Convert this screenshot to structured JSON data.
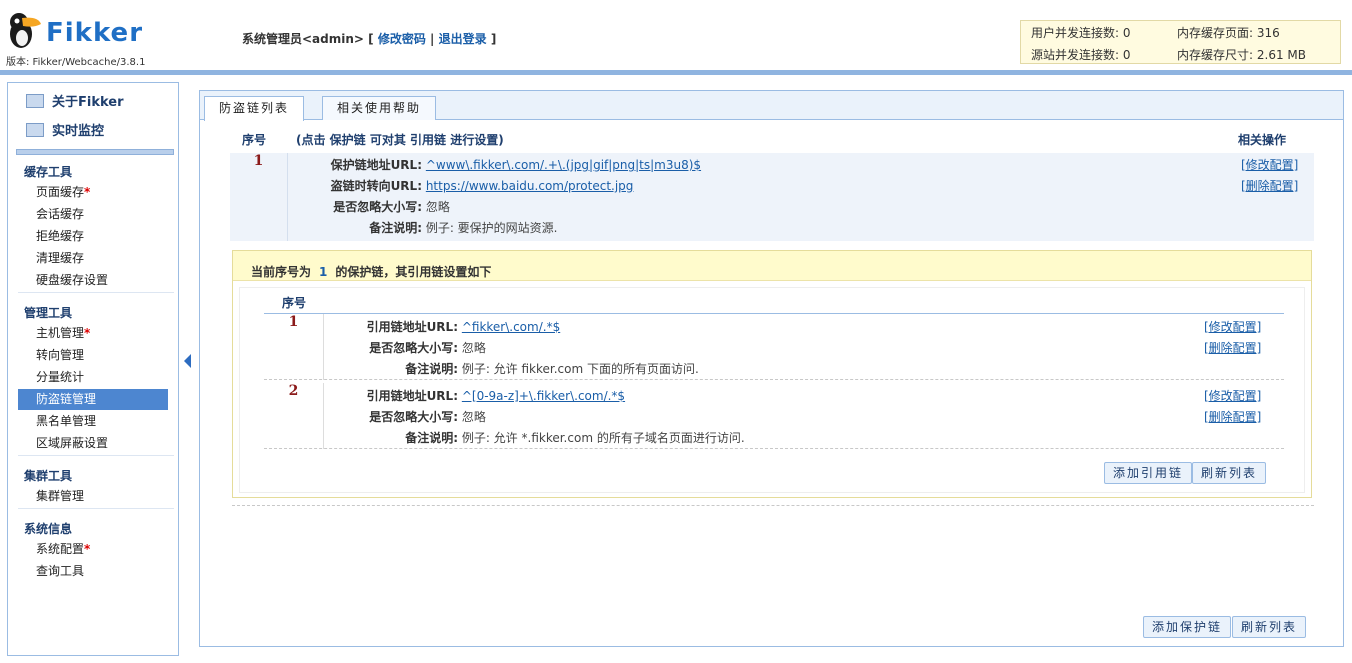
{
  "header": {
    "brand": "Fikker",
    "version": "版本: Fikker/Webcache/3.8.1",
    "user": "系统管理员<admin>",
    "bracket_open": "[",
    "change_password": "修改密码",
    "separator": "|",
    "logout": "退出登录",
    "bracket_close": "]"
  },
  "stats": {
    "user_conn_label": "用户并发连接数:",
    "user_conn_value": "0",
    "origin_conn_label": "源站并发连接数:",
    "origin_conn_value": "0",
    "mem_pages_label": "内存缓存页面:",
    "mem_pages_value": "316",
    "mem_size_label": "内存缓存尺寸:",
    "mem_size_value": "2.61 MB"
  },
  "sidebar": {
    "top": [
      {
        "label": "关于Fikker",
        "icon": "monitor-icon"
      },
      {
        "label": "实时监控",
        "icon": "chart-icon"
      }
    ],
    "groups": [
      {
        "title": "缓存工具",
        "items": [
          {
            "label": "页面缓存",
            "req": "*"
          },
          {
            "label": "会话缓存",
            "req": ""
          },
          {
            "label": "拒绝缓存",
            "req": ""
          },
          {
            "label": "清理缓存",
            "req": ""
          },
          {
            "label": "硬盘缓存设置",
            "req": ""
          }
        ]
      },
      {
        "title": "管理工具",
        "items": [
          {
            "label": "主机管理",
            "req": "*"
          },
          {
            "label": "转向管理",
            "req": ""
          },
          {
            "label": "分量统计",
            "req": ""
          },
          {
            "label": "防盗链管理",
            "req": ""
          },
          {
            "label": "黑名单管理",
            "req": ""
          },
          {
            "label": "区域屏蔽设置",
            "req": ""
          }
        ]
      },
      {
        "title": "集群工具",
        "items": [
          {
            "label": "集群管理",
            "req": ""
          }
        ]
      },
      {
        "title": "系统信息",
        "items": [
          {
            "label": "系统配置",
            "req": "*"
          },
          {
            "label": "查询工具",
            "req": ""
          }
        ]
      }
    ]
  },
  "tabs": [
    "防盗链列表",
    "相关使用帮助"
  ],
  "table": {
    "col_index": "序号",
    "col_hint": "(点击 保护链 可对其 引用链 进行设置)",
    "col_ops": "相关操作"
  },
  "chain": {
    "index": "1",
    "url_label": "保护链地址URL:",
    "url_value": "^www\\.fikker\\.com/.+\\.(jpg|gif|png|ts|m3u8)$",
    "redirect_label": "盗链时转向URL:",
    "redirect_value": "https://www.baidu.com/protect.jpg",
    "ignore_case_label": "是否忽略大小写:",
    "ignore_case_value": "忽略",
    "note_label": "备注说明:",
    "note_value": "例子: 要保护的网站资源.",
    "edit": "[修改配置]",
    "delete": "[删除配置]"
  },
  "sub": {
    "title_prefix": "当前序号为",
    "title_index": "1",
    "title_suffix": "的保护链，其引用链设置如下",
    "col_index": "序号",
    "rows": [
      {
        "index": "1",
        "url_label": "引用链地址URL:",
        "url_value": "^fikker\\.com/.*$",
        "ignore_case_label": "是否忽略大小写:",
        "ignore_case_value": "忽略",
        "note_label": "备注说明:",
        "note_value": "例子: 允许 fikker.com 下面的所有页面访问.",
        "edit": "[修改配置]",
        "delete": "[删除配置]"
      },
      {
        "index": "2",
        "url_label": "引用链地址URL:",
        "url_value": "^[0-9a-z]+\\.fikker\\.com/.*$",
        "ignore_case_label": "是否忽略大小写:",
        "ignore_case_value": "忽略",
        "note_label": "备注说明:",
        "note_value": "例子: 允许 *.fikker.com 的所有子域名页面进行访问.",
        "edit": "[修改配置]",
        "delete": "[删除配置]"
      }
    ],
    "add_button": "添加引用链",
    "refresh_button": "刷新列表"
  },
  "footer": {
    "add_button": "添加保护链",
    "refresh_button": "刷新列表"
  },
  "colors": {
    "accent": "#1f6fc5",
    "active_item": "#4d86d0",
    "index_red": "#8b1a1a"
  }
}
